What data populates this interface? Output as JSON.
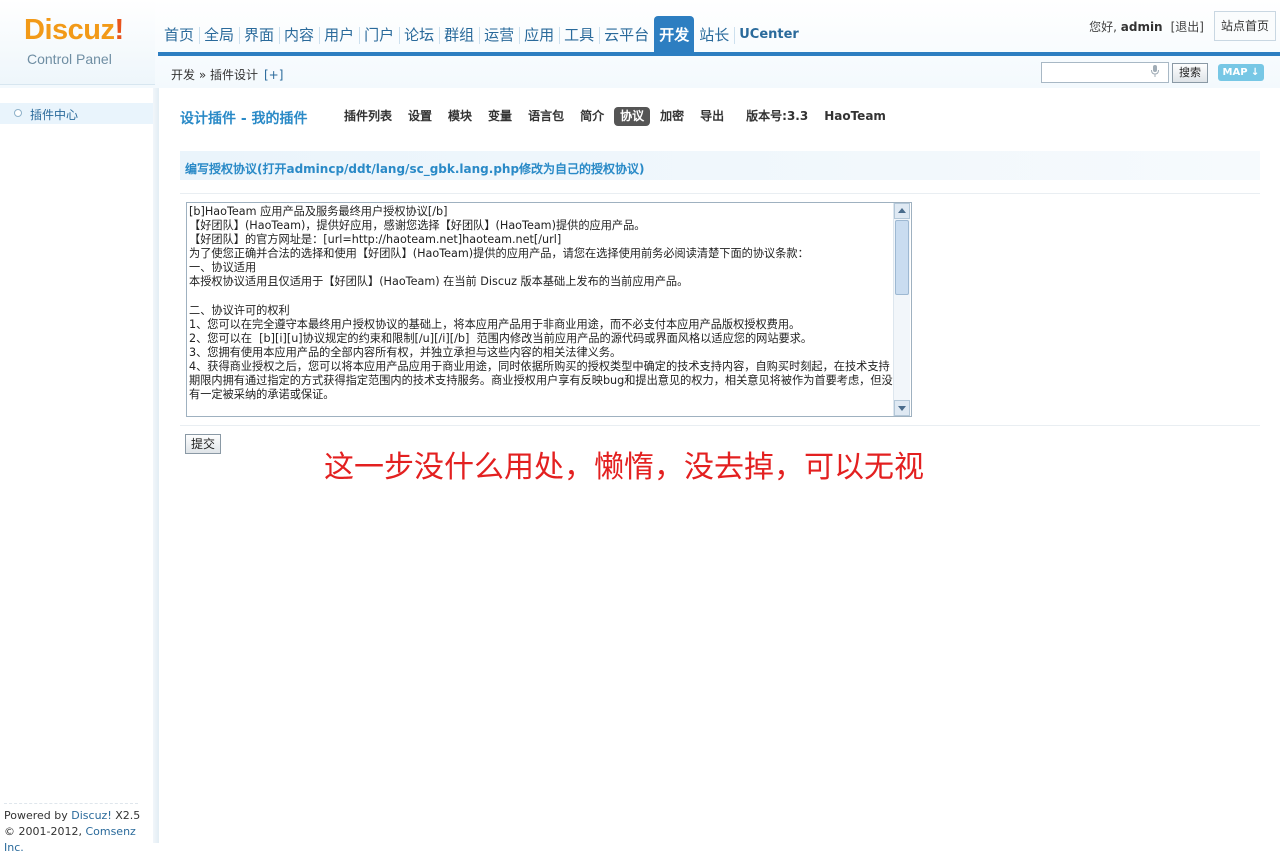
{
  "logo": {
    "brand": "Discuz",
    "bang": "!",
    "subtitle": "Control Panel"
  },
  "nav": {
    "items": [
      "首页",
      "全局",
      "界面",
      "内容",
      "用户",
      "门户",
      "论坛",
      "群组",
      "运营",
      "应用",
      "工具",
      "云平台",
      "开发",
      "站长",
      "UCenter"
    ],
    "active": "开发"
  },
  "user": {
    "greeting_prefix": "您好, ",
    "name": "admin",
    "logout": "[退出]",
    "site_home": "站点首页"
  },
  "breadcrumb": {
    "text": "开发 » 插件设计",
    "plus": "[+]"
  },
  "search": {
    "placeholder": "",
    "button": "搜索",
    "map": "MAP"
  },
  "sidebar": {
    "item": "插件中心",
    "powered_by": "Powered by",
    "brand_link": "Discuz!",
    "version": " X2.5",
    "copyright_prefix": "© 2001-2012, ",
    "company": "Comsenz Inc."
  },
  "main": {
    "title": "设计插件 - 我的插件",
    "tabs": [
      {
        "label": "插件列表",
        "active": false
      },
      {
        "label": "设置",
        "active": false
      },
      {
        "label": "模块",
        "active": false
      },
      {
        "label": "变量",
        "active": false
      },
      {
        "label": "语言包",
        "active": false
      },
      {
        "label": "简介",
        "active": false
      },
      {
        "label": "协议",
        "active": true
      },
      {
        "label": "加密",
        "active": false
      },
      {
        "label": "导出",
        "active": false
      }
    ],
    "version": "版本号:3.3",
    "author": "HaoTeam",
    "section_title": "编写授权协议(打开admincp/ddt/lang/sc_gbk.lang.php修改为自己的授权协议)",
    "agreement": "[b]HaoTeam 应用产品及服务最终用户授权协议[/b]\n【好团队】(HaoTeam)，提供好应用，感谢您选择【好团队】(HaoTeam)提供的应用产品。\n【好团队】的官方网址是：[url=http://haoteam.net]haoteam.net[/url]\n为了使您正确并合法的选择和使用【好团队】(HaoTeam)提供的应用产品，请您在选择使用前务必阅读清楚下面的协议条款：\n一、协议适用\n本授权协议适用且仅适用于【好团队】(HaoTeam) 在当前 Discuz 版本基础上发布的当前应用产品。\n\n二、协议许可的权利\n1、您可以在完全遵守本最终用户授权协议的基础上，将本应用产品用于非商业用途，而不必支付本应用产品版权授权费用。\n2、您可以在  [b][i][u]协议规定的约束和限制[/u][/i][/b]  范围内修改当前应用产品的源代码或界面风格以适应您的网站要求。\n3、您拥有使用本应用产品的全部内容所有权，并独立承担与这些内容的相关法律义务。\n4、获得商业授权之后，您可以将本应用产品应用于商业用途，同时依据所购买的授权类型中确定的技术支持内容，自购买时刻起，在技术支持期限内拥有通过指定的方式获得指定范围内的技术支持服务。商业授权用户享有反映bug和提出意见的权力，相关意见将被作为首要考虑，但没有一定被采纳的承诺或保证。",
    "submit": "提交"
  },
  "annotation": "这一步没什么用处，懒惰，没去掉，可以无视"
}
